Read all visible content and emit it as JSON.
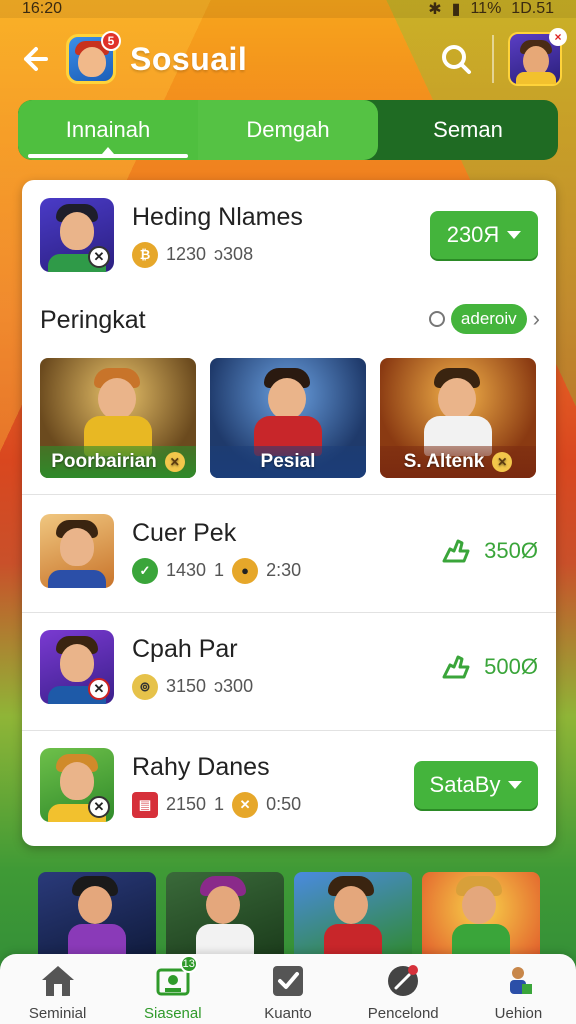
{
  "status_bar": {
    "time": "16:20",
    "battery": "11%",
    "clock_right": "1D.51"
  },
  "header": {
    "title": "Sosuail",
    "app_badge": "5",
    "profile_badge": "×"
  },
  "tabs": [
    {
      "label": "Innainah",
      "active": true
    },
    {
      "label": "Demgah",
      "active": false
    },
    {
      "label": "Seman",
      "active": false
    }
  ],
  "top_player": {
    "name": "Heding Nlames",
    "stat_a": "1230",
    "stat_b": "ɔ308",
    "button_label": "230Я"
  },
  "ranking": {
    "title": "Peringkat",
    "pill_label": "aderoiv",
    "cards": [
      {
        "label": "Poorbairian"
      },
      {
        "label": "Pesial"
      },
      {
        "label": "S. Altenk"
      }
    ]
  },
  "players": [
    {
      "name": "Cuer Pek",
      "stat_a": "1430",
      "mid": "1",
      "stat_b": "2:30",
      "score": "350Ø"
    },
    {
      "name": "Cpah Par",
      "stat_a": "3150",
      "mid": "",
      "stat_b": "ɔ300",
      "score": "500Ø"
    },
    {
      "name": "Rahy Danes",
      "stat_a": "2150",
      "mid": "1",
      "stat_b": "0:50",
      "button_label": "SataBy"
    }
  ],
  "bottom_nav": [
    {
      "label": "Seminial",
      "active": false
    },
    {
      "label": "Siasenal",
      "active": true,
      "badge": "13"
    },
    {
      "label": "Kuanto",
      "active": false
    },
    {
      "label": "Pencelond",
      "active": false
    },
    {
      "label": "Uehion",
      "active": false
    }
  ],
  "colors": {
    "accent_green": "#44b43c",
    "header_orange": "#f28a1d",
    "dark_green": "#1f6b23"
  }
}
